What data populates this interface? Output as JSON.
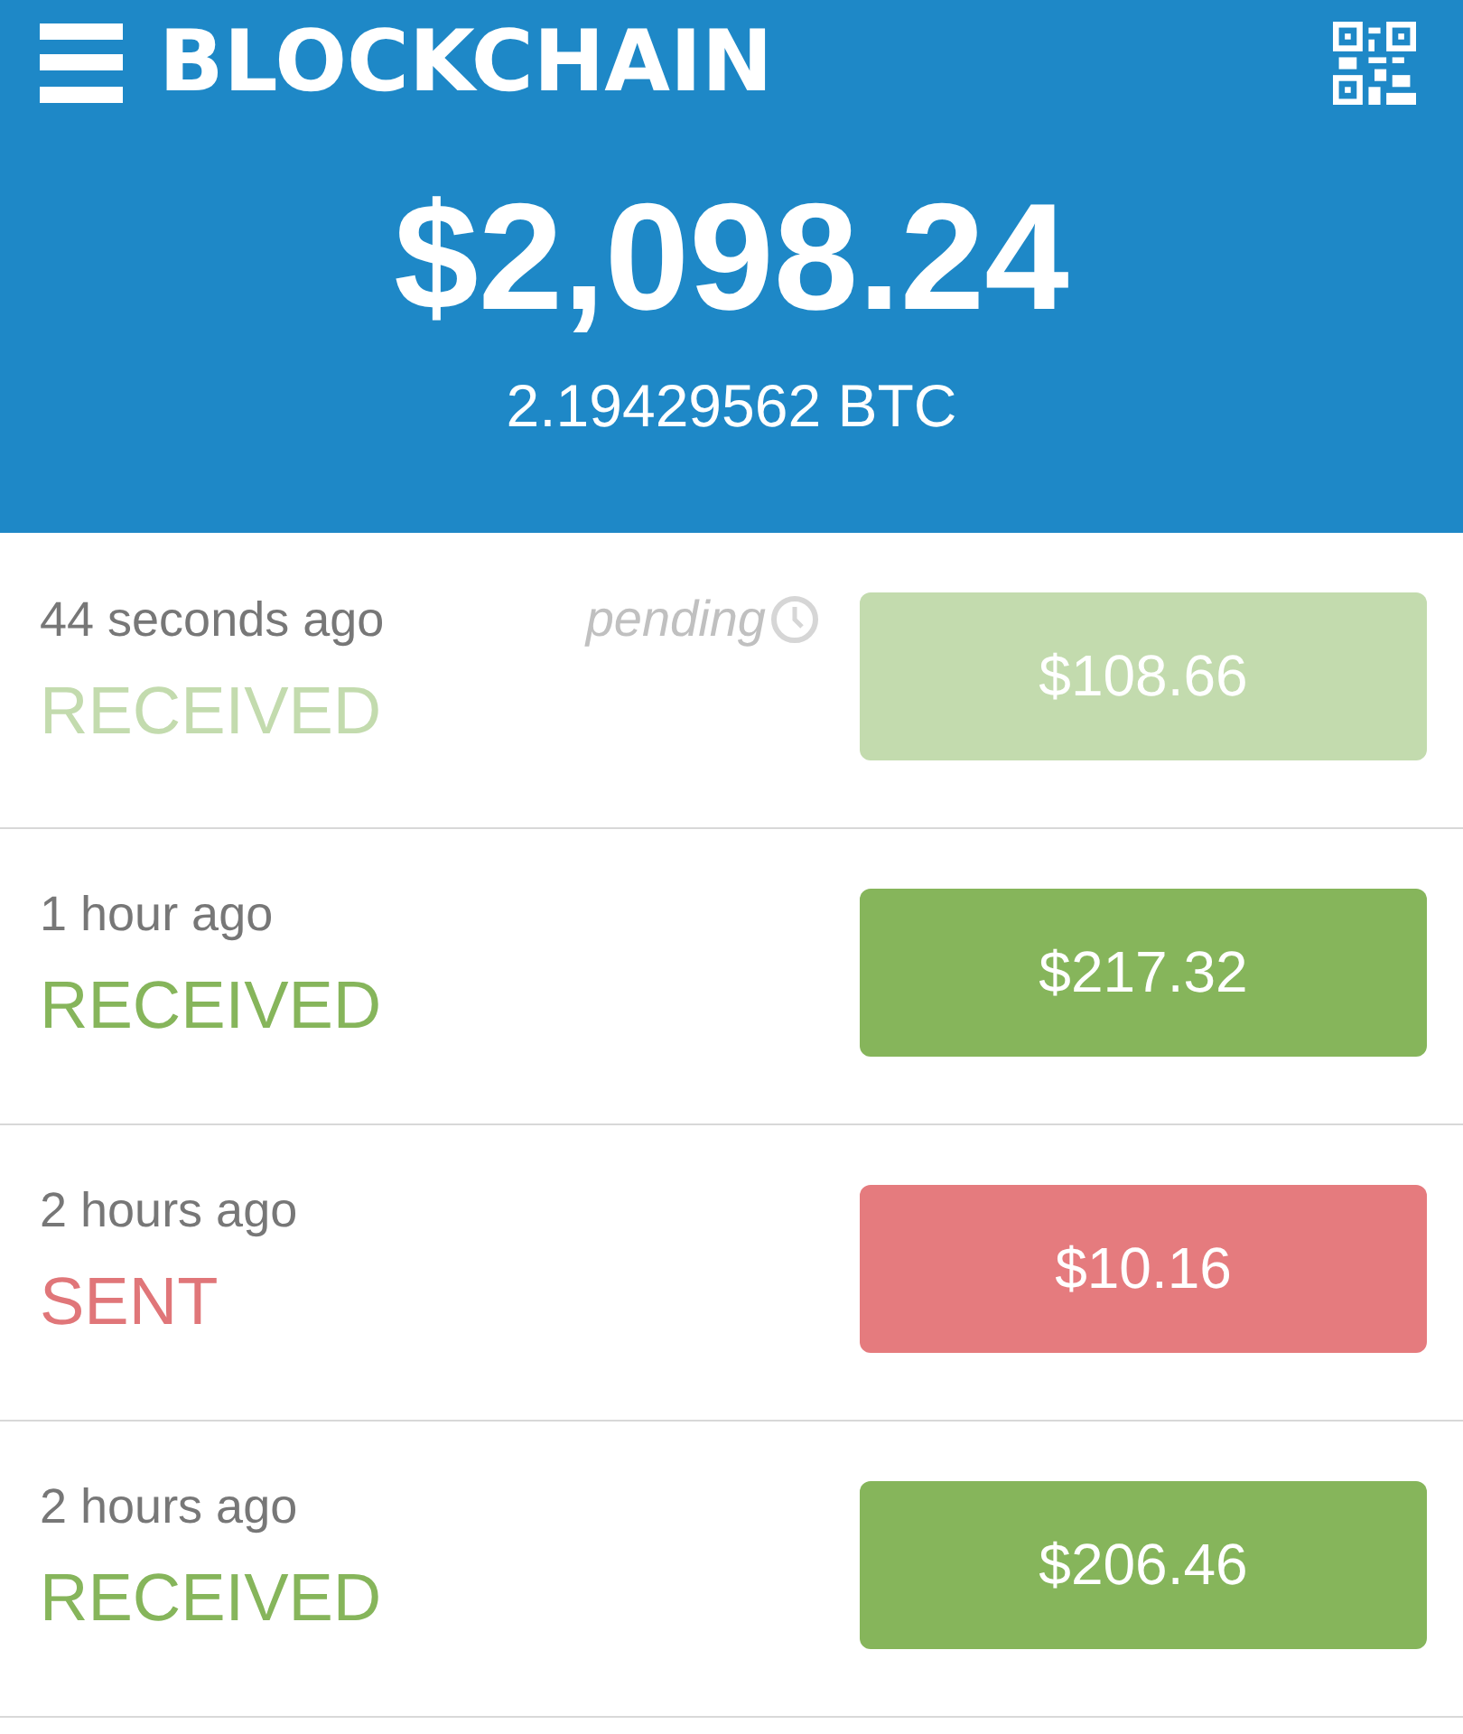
{
  "header": {
    "logo": "BLOCKCHAIN",
    "balance": "$2,098.24",
    "btc_balance": "2.19429562 BTC"
  },
  "transactions": [
    {
      "time": "44 seconds ago",
      "direction": "RECEIVED",
      "kind": "received",
      "pending": true,
      "status": "pending",
      "amount": "$108.66"
    },
    {
      "time": "1 hour ago",
      "direction": "RECEIVED",
      "kind": "received",
      "pending": false,
      "amount": "$217.32"
    },
    {
      "time": "2 hours ago",
      "direction": "SENT",
      "kind": "sent",
      "pending": false,
      "amount": "$10.16"
    },
    {
      "time": "2 hours ago",
      "direction": "RECEIVED",
      "kind": "received",
      "pending": false,
      "amount": "$206.46"
    }
  ]
}
